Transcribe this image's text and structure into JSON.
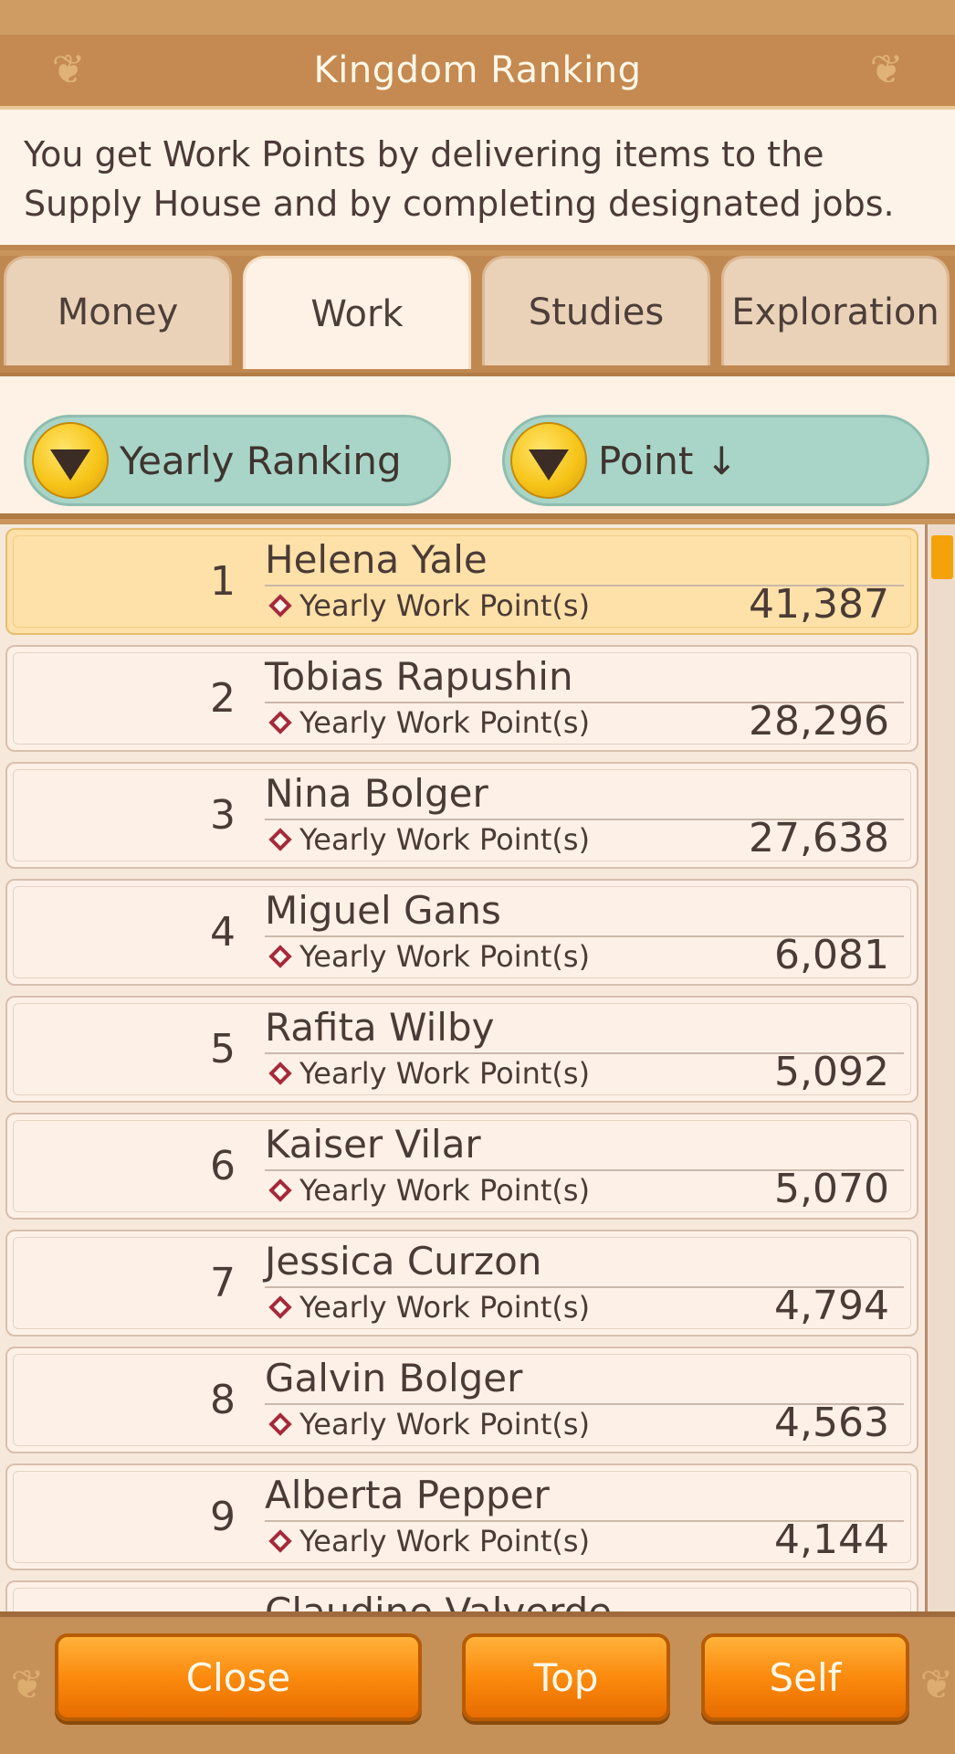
{
  "header": {
    "title": "Kingdom Ranking"
  },
  "description": [
    "You get Work Points by delivering items to the",
    "Supply House and by completing designated jobs."
  ],
  "tabs": [
    {
      "label": "Money",
      "active": false
    },
    {
      "label": "Work",
      "active": true
    },
    {
      "label": "Studies",
      "active": false
    },
    {
      "label": "Exploration",
      "active": false
    }
  ],
  "filters": {
    "period": "Yearly Ranking",
    "sort": "Point ↓"
  },
  "ranking": {
    "points_label": "Yearly Work Point(s)",
    "entries": [
      {
        "rank": "1",
        "name": "Helena Yale",
        "points": "41,387"
      },
      {
        "rank": "2",
        "name": "Tobias Rapushin",
        "points": "28,296"
      },
      {
        "rank": "3",
        "name": "Nina Bolger",
        "points": "27,638"
      },
      {
        "rank": "4",
        "name": "Miguel Gans",
        "points": "6,081"
      },
      {
        "rank": "5",
        "name": "Rafita Wilby",
        "points": "5,092"
      },
      {
        "rank": "6",
        "name": "Kaiser Vilar",
        "points": "5,070"
      },
      {
        "rank": "7",
        "name": "Jessica Curzon",
        "points": "4,794"
      },
      {
        "rank": "8",
        "name": "Galvin Bolger",
        "points": "4,563"
      },
      {
        "rank": "9",
        "name": "Alberta Pepper",
        "points": "4,144"
      }
    ],
    "partial_name": "Claudine Valverde"
  },
  "footer": {
    "close": "Close",
    "top": "Top",
    "self": "Self"
  },
  "colors": {
    "accent_orange": "#fb8a0d",
    "highlight_row": "#fde1a8",
    "pill_teal": "#a8d5c8",
    "rank_diamond": "#a52a3a"
  }
}
